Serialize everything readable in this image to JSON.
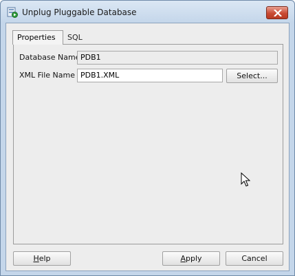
{
  "window": {
    "title": "Unplug Pluggable Database"
  },
  "tabs": [
    {
      "label": "Properties",
      "active": true
    },
    {
      "label": "SQL",
      "active": false
    }
  ],
  "form": {
    "database_name": {
      "label": "Database Name",
      "value": "PDB1"
    },
    "xml_file_name": {
      "label": "XML File Name",
      "value": "PDB1.XML"
    },
    "select_label": "Select..."
  },
  "buttons": {
    "help_mnemonic": "H",
    "help_rest": "elp",
    "apply_mnemonic": "A",
    "apply_rest": "pply",
    "cancel": "Cancel"
  },
  "icons": {
    "app": "pluggable-database-icon",
    "close": "close-icon",
    "cursor": "mouse-pointer-icon"
  },
  "colors": {
    "close_button": "#c94a33",
    "window_frame": "#c4d6ea",
    "dialog_background": "#ededed"
  }
}
